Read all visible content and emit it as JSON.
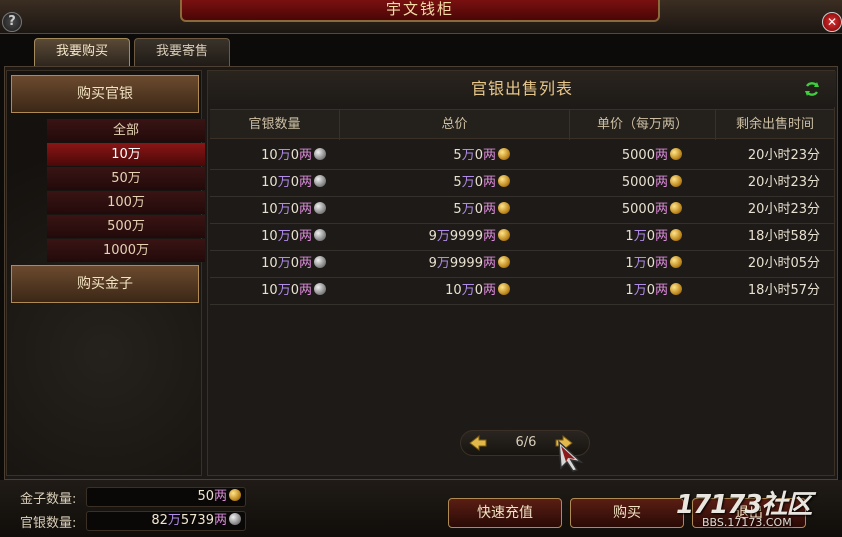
{
  "window": {
    "title": "宇文钱柜",
    "help_label": "?",
    "close_label": "✕"
  },
  "tabs": [
    {
      "label": "我要购买",
      "active": true
    },
    {
      "label": "我要寄售",
      "active": false
    }
  ],
  "sidebar": {
    "buy_silver": "购买官银",
    "sub_items": [
      {
        "label": "全部",
        "selected": false
      },
      {
        "label": "10万",
        "selected": true
      },
      {
        "label": "50万",
        "selected": false
      },
      {
        "label": "100万",
        "selected": false
      },
      {
        "label": "500万",
        "selected": false
      },
      {
        "label": "1000万",
        "selected": false
      }
    ],
    "buy_gold": "购买金子"
  },
  "list": {
    "title": "官银出售列表",
    "columns": [
      "官银数量",
      "总价",
      "单价（每万两）",
      "剩余出售时间"
    ],
    "rows": [
      {
        "qty_num": "10",
        "qty_wan": "万",
        "qty_rest": "0",
        "total_pre": "5",
        "total_wan": "万",
        "total_rest": "0",
        "unit_pre": "5000",
        "unit_wan": "",
        "unit_rest": "",
        "time": "20小时23分"
      },
      {
        "qty_num": "10",
        "qty_wan": "万",
        "qty_rest": "0",
        "total_pre": "5",
        "total_wan": "万",
        "total_rest": "0",
        "unit_pre": "5000",
        "unit_wan": "",
        "unit_rest": "",
        "time": "20小时23分"
      },
      {
        "qty_num": "10",
        "qty_wan": "万",
        "qty_rest": "0",
        "total_pre": "5",
        "total_wan": "万",
        "total_rest": "0",
        "unit_pre": "5000",
        "unit_wan": "",
        "unit_rest": "",
        "time": "20小时23分"
      },
      {
        "qty_num": "10",
        "qty_wan": "万",
        "qty_rest": "0",
        "total_pre": "9",
        "total_wan": "万",
        "total_rest": "9999",
        "unit_pre": "1",
        "unit_wan": "万",
        "unit_rest": "0",
        "time": "18小时58分"
      },
      {
        "qty_num": "10",
        "qty_wan": "万",
        "qty_rest": "0",
        "total_pre": "9",
        "total_wan": "万",
        "total_rest": "9999",
        "unit_pre": "1",
        "unit_wan": "万",
        "unit_rest": "0",
        "time": "20小时05分"
      },
      {
        "qty_num": "10",
        "qty_wan": "万",
        "qty_rest": "0",
        "total_pre": "10",
        "total_wan": "万",
        "total_rest": "0",
        "unit_pre": "1",
        "unit_wan": "万",
        "unit_rest": "0",
        "time": "18小时57分"
      }
    ],
    "liang": "两"
  },
  "pager": {
    "text": "6/6"
  },
  "balances": {
    "gold_label": "金子数量:",
    "gold_value_num": "50",
    "silver_label": "官银数量:",
    "silver_value_pre": "82",
    "silver_value_wan": "万",
    "silver_value_rest": "5739",
    "liang": "两"
  },
  "actions": {
    "recharge": "快速充值",
    "buy": "购买",
    "exit": "退出"
  },
  "watermark": {
    "logo": "17173社区",
    "site": "BBS.17173.COM"
  },
  "colors": {
    "accent_gold": "#e8c889",
    "wan_purple": "#b08ce8",
    "liang_pink": "#d98ad8",
    "selected_red": "#8a1616"
  }
}
